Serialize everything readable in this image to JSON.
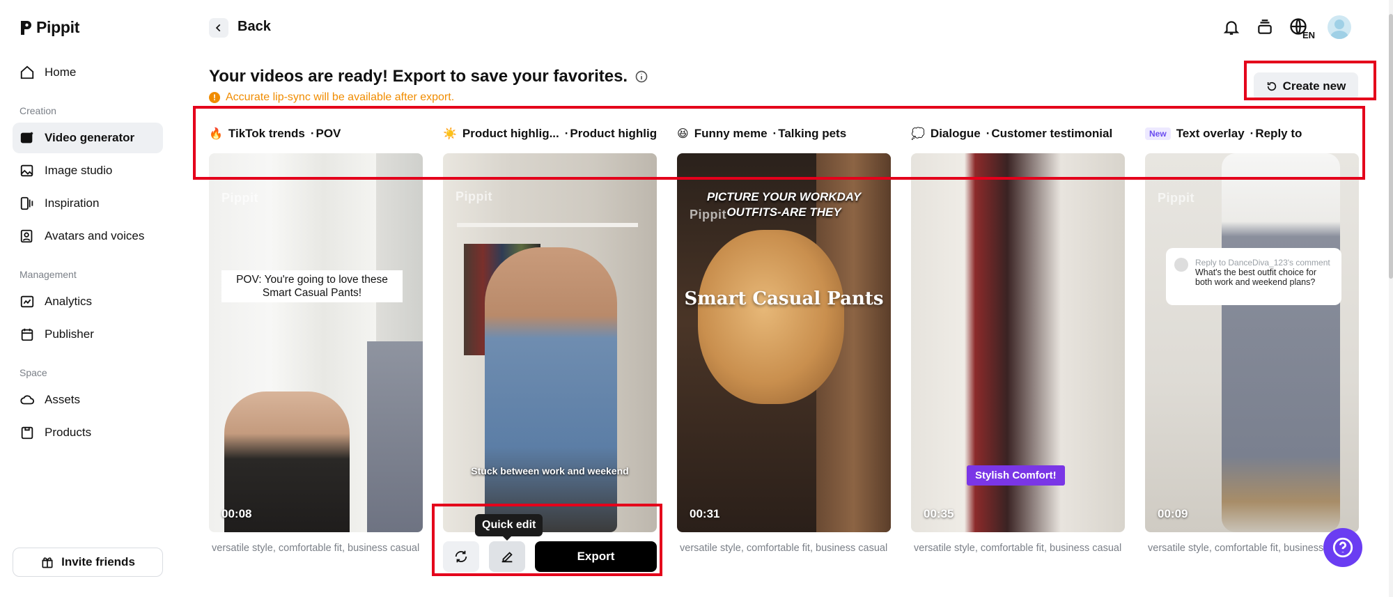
{
  "app": {
    "name": "Pippit"
  },
  "sidebar": {
    "home": "Home",
    "sections": [
      {
        "label": "Creation",
        "items": [
          "Video generator",
          "Image studio",
          "Inspiration",
          "Avatars and voices"
        ]
      },
      {
        "label": "Management",
        "items": [
          "Analytics",
          "Publisher"
        ]
      },
      {
        "label": "Space",
        "items": [
          "Assets",
          "Products"
        ]
      }
    ],
    "active_item": "Video generator",
    "invite_label": "Invite friends"
  },
  "header": {
    "back_label": "Back",
    "lang_label": "EN",
    "icons": [
      "bell-icon",
      "stack-icon",
      "globe-icon",
      "avatar"
    ]
  },
  "main": {
    "title": "Your videos are ready! Export to save your favorites.",
    "warning": "Accurate lip-sync will be available after export.",
    "create_new_label": "Create new",
    "cards": [
      {
        "emoji": "🔥",
        "category": "TikTok trends",
        "style": "POV",
        "duration": "00:08",
        "overlay_text": "POV: You're going to love these Smart Casual Pants!",
        "watermark": "Pippit",
        "caption": "versatile style, comfortable fit, business casual"
      },
      {
        "emoji": "☀️",
        "category": "Product highlig...",
        "style": "Product highlig...",
        "overlay_text": "Stuck between work and weekend",
        "watermark": "Pippit",
        "tooltip": "Quick edit",
        "export_label": "Export"
      },
      {
        "emoji": "😆",
        "category": "Funny meme",
        "style": "Talking pets",
        "duration": "00:31",
        "overlay_text_top": "PICTURE YOUR WORKDAY OUTFITS-ARE THEY",
        "overlay_text_mid": "Smart Casual Pants",
        "watermark": "Pippit",
        "caption": "versatile style, comfortable fit, business casual"
      },
      {
        "emoji": "💭",
        "category": "Dialogue",
        "style": "Customer testimonial",
        "duration": "00:35",
        "overlay_text": "Stylish Comfort!",
        "caption": "versatile style, comfortable fit, business casual"
      },
      {
        "badge": "New",
        "category": "Text overlay",
        "style": "Reply to",
        "duration": "00:09",
        "watermark": "Pippit",
        "comment_reply": "Reply to DanceDiva_123's comment",
        "comment_question": "What's the best outfit choice for both work and weekend plans?",
        "caption": "versatile style, comfortable fit, business casual"
      }
    ]
  },
  "colors": {
    "accent_red": "#e4001b",
    "warning": "#f08c00",
    "help_button": "#6a3df2",
    "active_nav_bg": "#eef0f3"
  }
}
